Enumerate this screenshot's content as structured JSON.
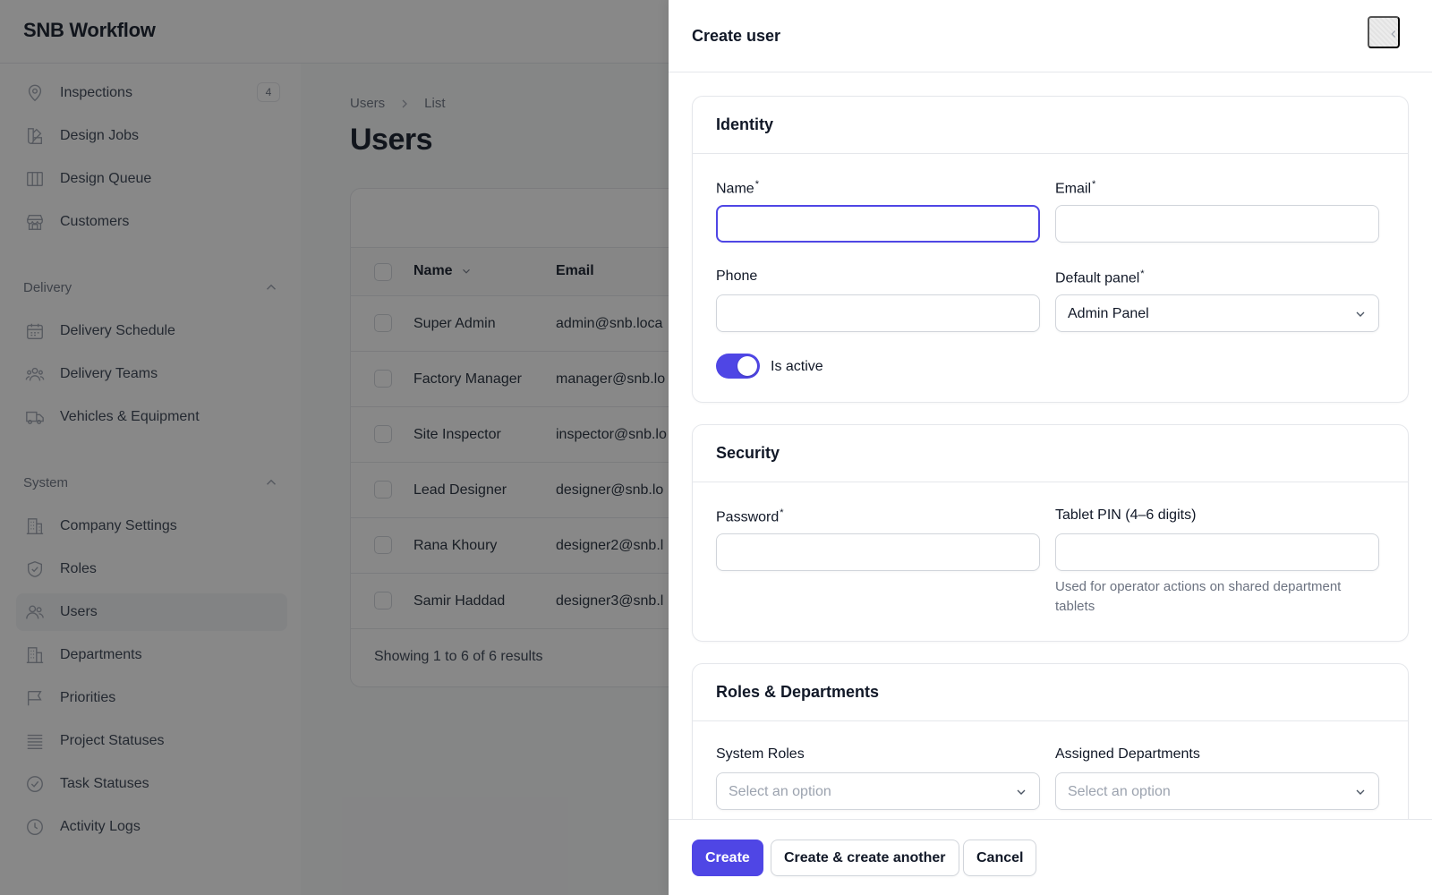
{
  "app": {
    "brand": "SNB Workflow"
  },
  "sidebar": {
    "items_top": [
      {
        "label": "Inspections",
        "icon": "map-pin-icon",
        "badge": "4"
      },
      {
        "label": "Design Jobs",
        "icon": "swatch-icon"
      },
      {
        "label": "Design Queue",
        "icon": "columns-icon"
      },
      {
        "label": "Customers",
        "icon": "storefront-icon"
      }
    ],
    "groups": [
      {
        "label": "Delivery",
        "items": [
          {
            "label": "Delivery Schedule",
            "icon": "calendar-icon"
          },
          {
            "label": "Delivery Teams",
            "icon": "user-group-icon"
          },
          {
            "label": "Vehicles & Equipment",
            "icon": "truck-icon"
          }
        ]
      },
      {
        "label": "System",
        "items": [
          {
            "label": "Company Settings",
            "icon": "building-icon"
          },
          {
            "label": "Roles",
            "icon": "shield-check-icon"
          },
          {
            "label": "Users",
            "icon": "users-icon",
            "active": true
          },
          {
            "label": "Departments",
            "icon": "office-building-icon"
          },
          {
            "label": "Priorities",
            "icon": "flag-icon"
          },
          {
            "label": "Project Statuses",
            "icon": "queue-list-icon"
          },
          {
            "label": "Task Statuses",
            "icon": "check-circle-icon"
          },
          {
            "label": "Activity Logs",
            "icon": "clock-icon"
          }
        ]
      }
    ]
  },
  "main": {
    "breadcrumb": [
      "Users",
      "List"
    ],
    "title": "Users",
    "table": {
      "columns": [
        "Name",
        "Email"
      ],
      "rows": [
        {
          "name": "Super Admin",
          "email": "admin@snb.loca"
        },
        {
          "name": "Factory Manager",
          "email": "manager@snb.lo"
        },
        {
          "name": "Site Inspector",
          "email": "inspector@snb.lo"
        },
        {
          "name": "Lead Designer",
          "email": "designer@snb.lo"
        },
        {
          "name": "Rana Khoury",
          "email": "designer2@snb.l"
        },
        {
          "name": "Samir Haddad",
          "email": "designer3@snb.l"
        }
      ],
      "footer": "Showing 1 to 6 of 6 results"
    }
  },
  "modal": {
    "title": "Create user",
    "identity": {
      "title": "Identity",
      "name_label": "Name",
      "name_value": "",
      "email_label": "Email",
      "email_value": "",
      "phone_label": "Phone",
      "phone_value": "",
      "default_panel_label": "Default panel",
      "default_panel_value": "Admin Panel",
      "is_active_label": "Is active",
      "is_active": true,
      "required_mark": "*"
    },
    "security": {
      "title": "Security",
      "password_label": "Password",
      "password_value": "",
      "pin_label": "Tablet PIN (4–6 digits)",
      "pin_value": "",
      "pin_hint": "Used for operator actions on shared department tablets"
    },
    "roles": {
      "title": "Roles & Departments",
      "system_roles_label": "System Roles",
      "system_roles_placeholder": "Select an option",
      "departments_label": "Assigned Departments",
      "departments_placeholder": "Select an option"
    },
    "footer": {
      "create": "Create",
      "create_another": "Create & create another",
      "cancel": "Cancel"
    }
  },
  "colors": {
    "primary": "#4f46e5",
    "overlay": "rgba(17,17,17,0.5)"
  }
}
